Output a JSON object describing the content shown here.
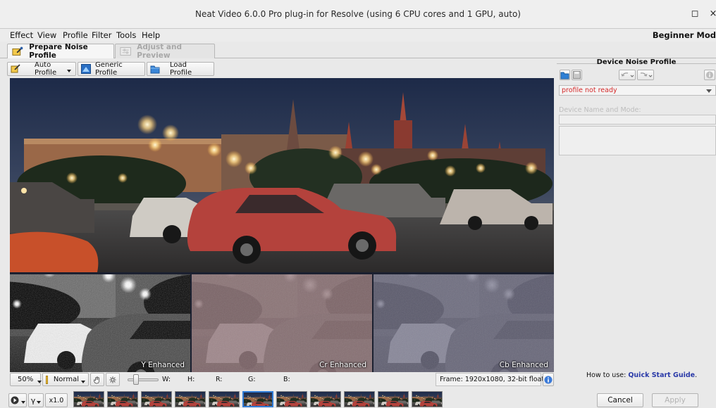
{
  "window": {
    "title": "Neat Video 6.0.0 Pro plug-in for Resolve (using 6 CPU cores and 1 GPU, auto)",
    "maximize_glyph": "◻",
    "close_glyph": "×"
  },
  "menu": {
    "items": [
      "Effect",
      "View",
      "Profile",
      "Filter",
      "Tools",
      "Help"
    ],
    "mode": "Beginner Mod"
  },
  "tabs": [
    {
      "label": "Prepare Noise Profile",
      "icon": "prepare-profile-icon"
    },
    {
      "label": "Adjust and Preview",
      "icon": "adjust-sliders-icon"
    }
  ],
  "toolbar": {
    "auto_profile": "Auto Profile",
    "generic_profile": "Generic Profile",
    "load_profile": "Load Profile"
  },
  "viewer": {
    "channels": [
      "Y Enhanced",
      "Cr Enhanced",
      "Cb Enhanced"
    ]
  },
  "statusbar": {
    "zoom": "50%",
    "blend_mode": "Normal",
    "w_label": "W:",
    "h_label": "H:",
    "r_label": "R:",
    "g_label": "G:",
    "b_label": "B:",
    "frame_info": "Frame: 1920x1080, 32-bit float"
  },
  "bottombar": {
    "speed": "x1.0",
    "thumbnail_count": 11,
    "selected_thumbnail": 5,
    "cancel": "Cancel",
    "apply": "Apply"
  },
  "device_panel": {
    "title": "Device Noise Profile",
    "status": "profile not ready",
    "device_name_label": "Device Name and Mode:",
    "howto_prefix": "How to use: ",
    "howto_link": "Quick Start Guide",
    "howto_suffix": "."
  },
  "colors": {
    "accent": "#2f7bd6",
    "status_error": "#d42a2a",
    "link": "#2a3aa8"
  }
}
